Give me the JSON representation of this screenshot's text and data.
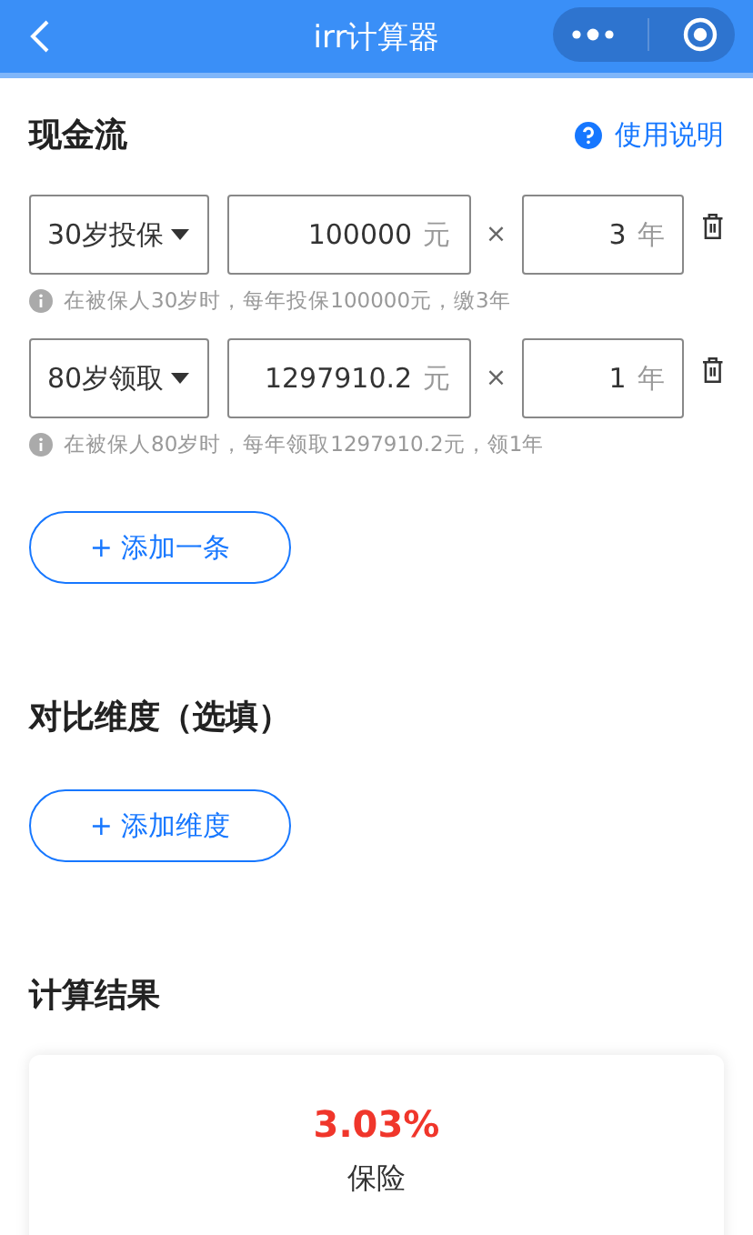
{
  "nav": {
    "title": "irr计算器"
  },
  "cashflow": {
    "title": "现金流",
    "help": "使用说明",
    "rows": [
      {
        "age": "30岁投保",
        "amount": "100000",
        "unit": "元",
        "times": "×",
        "years": "3",
        "years_unit": "年",
        "hint": "在被保人30岁时，每年投保100000元，缴3年"
      },
      {
        "age": "80岁领取",
        "amount": "1297910.2",
        "unit": "元",
        "times": "×",
        "years": "1",
        "years_unit": "年",
        "hint": "在被保人80岁时，每年领取1297910.2元，领1年"
      }
    ],
    "add_button": "+ 添加一条"
  },
  "compare": {
    "title": "对比维度（选填）",
    "add_button": "+ 添加维度"
  },
  "result": {
    "title": "计算结果",
    "rate": "3.03%",
    "label": "保险"
  }
}
